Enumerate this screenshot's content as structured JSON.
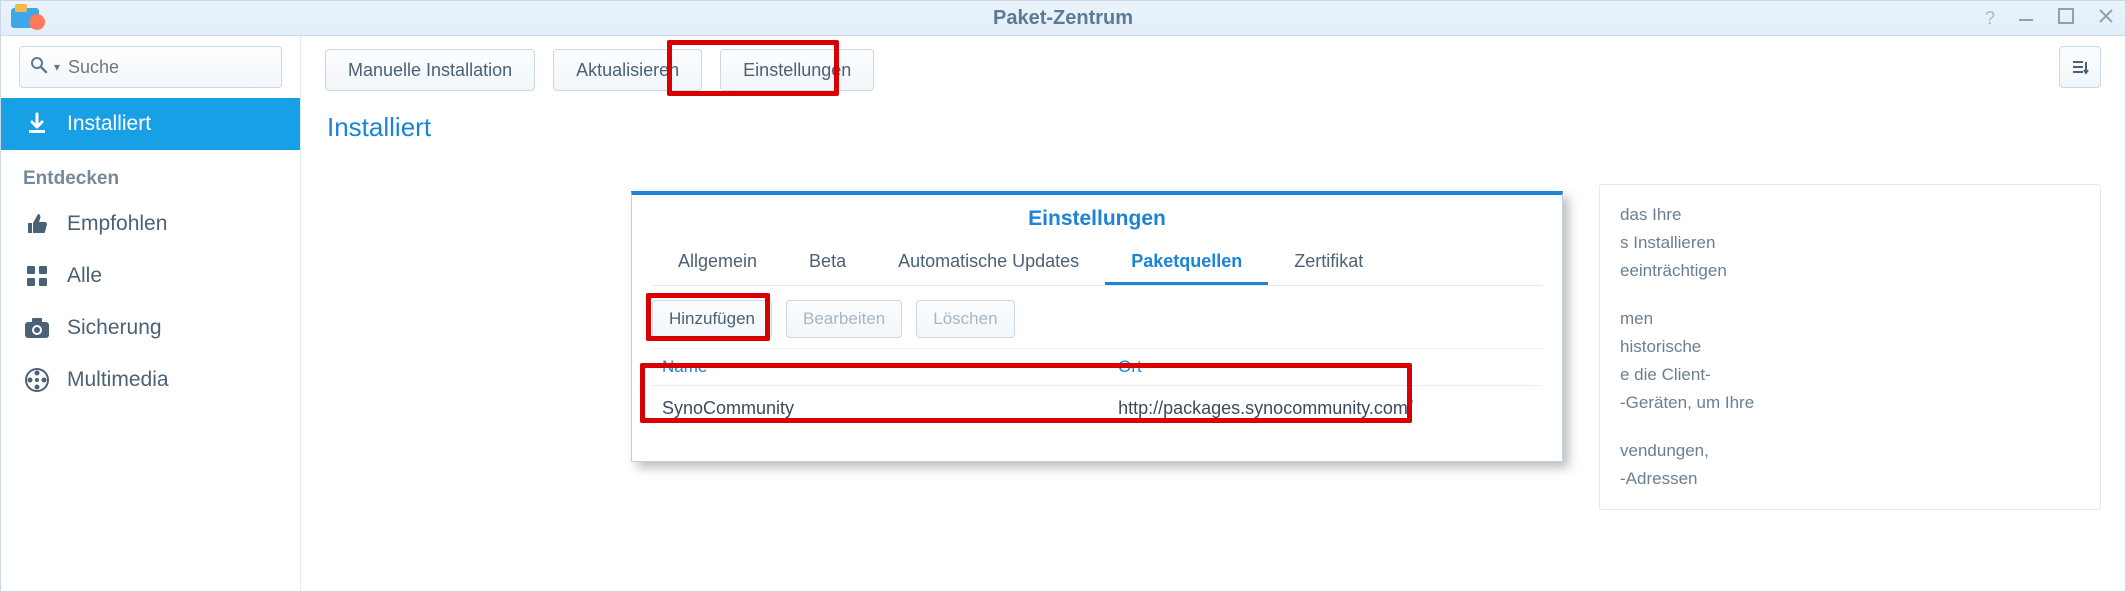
{
  "window": {
    "title": "Paket-Zentrum"
  },
  "search": {
    "placeholder": "Suche"
  },
  "sidebar": {
    "installed": "Installiert",
    "discover_heading": "Entdecken",
    "items": [
      {
        "label": "Empfohlen"
      },
      {
        "label": "Alle"
      },
      {
        "label": "Sicherung"
      },
      {
        "label": "Multimedia"
      }
    ]
  },
  "toolbar": {
    "manual_install": "Manuelle Installation",
    "refresh": "Aktualisieren",
    "settings": "Einstellungen"
  },
  "page_heading": "Installiert",
  "background_text": {
    "p1a": "das Ihre",
    "p1b": "s Installieren",
    "p1c": "eeinträchtigen",
    "p2a": "men",
    "p2b": "historische",
    "p2c": "e die Client-",
    "p2d": "-Geräten, um Ihre",
    "p3a": "vendungen,",
    "p3b": "-Adressen"
  },
  "modal": {
    "title": "Einstellungen",
    "tabs": {
      "general": "Allgemein",
      "beta": "Beta",
      "auto_updates": "Automatische Updates",
      "sources": "Paketquellen",
      "certificate": "Zertifikat"
    },
    "buttons": {
      "add": "Hinzufügen",
      "edit": "Bearbeiten",
      "delete": "Löschen"
    },
    "columns": {
      "name": "Name",
      "location": "Ort"
    },
    "rows": [
      {
        "name": "SynoCommunity",
        "location": "http://packages.synocommunity.com/"
      }
    ]
  }
}
